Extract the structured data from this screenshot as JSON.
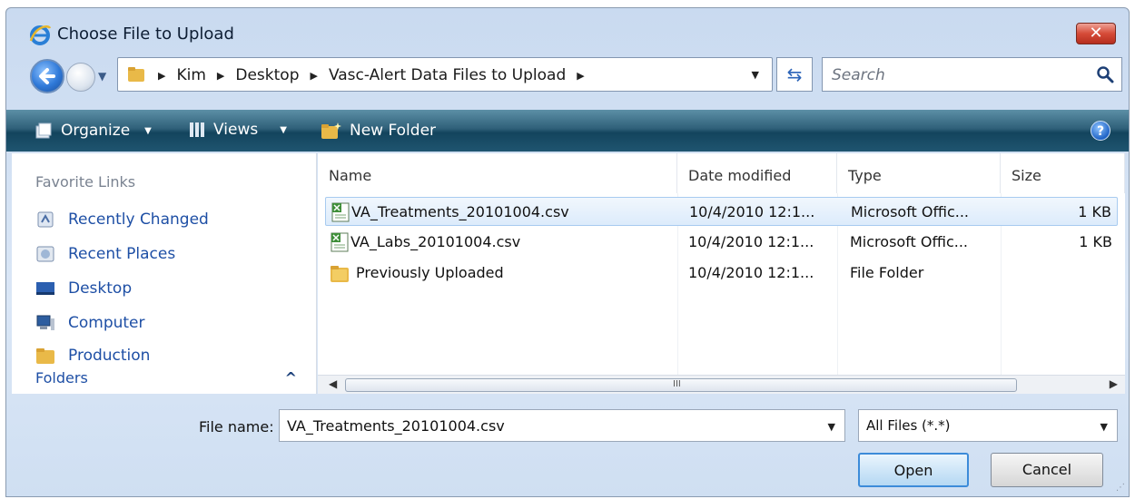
{
  "window": {
    "title": "Choose File to Upload",
    "close_label": "✕"
  },
  "address": {
    "crumbs": [
      "Kim",
      "Desktop",
      "Vasc-Alert Data Files to Upload"
    ],
    "search_placeholder": "Search"
  },
  "toolbar": {
    "organize": "Organize",
    "views": "Views",
    "new_folder": "New Folder",
    "help": "?"
  },
  "navpane": {
    "favorites_title": "Favorite Links",
    "items": [
      "Recently Changed",
      "Recent Places",
      "Desktop",
      "Computer",
      "Production"
    ],
    "folders_label": "Folders"
  },
  "filelist": {
    "columns": [
      "Name",
      "Date modified",
      "Type",
      "Size"
    ],
    "rows": [
      {
        "name": "VA_Treatments_20101004.csv",
        "date": "10/4/2010 12:1...",
        "type": "Microsoft Offic...",
        "size": "1 KB",
        "icon": "excel-csv-icon",
        "selected": true
      },
      {
        "name": "VA_Labs_20101004.csv",
        "date": "10/4/2010 12:1...",
        "type": "Microsoft Offic...",
        "size": "1 KB",
        "icon": "excel-csv-icon",
        "selected": false
      },
      {
        "name": "Previously Uploaded",
        "date": "10/4/2010 12:1...",
        "type": "File Folder",
        "size": "",
        "icon": "folder-icon",
        "selected": false
      }
    ]
  },
  "bottom": {
    "file_name_label": "File name:",
    "file_name_value": "VA_Treatments_20101004.csv",
    "filter_value": "All Files (*.*)",
    "open_label": "Open",
    "cancel_label": "Cancel"
  },
  "colors": {
    "toolbar": "#1f5570",
    "link": "#1e4fa5",
    "selection": "#dcebfb"
  }
}
